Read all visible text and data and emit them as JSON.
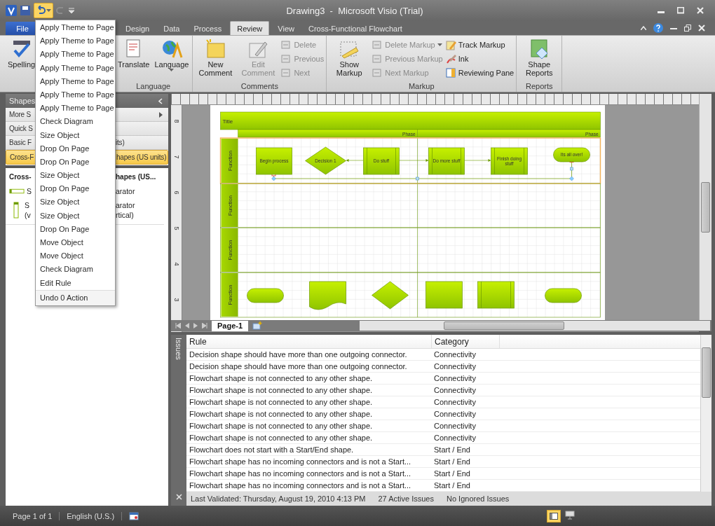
{
  "window": {
    "title": "Drawing3  -  Microsoft Visio (Trial)"
  },
  "quick_access": {
    "undo_open": true
  },
  "tabs": [
    {
      "label": "File",
      "kind": "file",
      "selected": false
    },
    {
      "label": "Design",
      "kind": "tab",
      "selected": false
    },
    {
      "label": "Data",
      "kind": "tab",
      "selected": false
    },
    {
      "label": "Process",
      "kind": "tab",
      "selected": false
    },
    {
      "label": "Review",
      "kind": "tab",
      "selected": true
    },
    {
      "label": "View",
      "kind": "tab",
      "selected": false
    },
    {
      "label": "Cross-Functional Flowchart",
      "kind": "tab",
      "selected": false
    }
  ],
  "ribbon": {
    "groups": [
      {
        "items": [
          {
            "kind": "large",
            "label": "Spelling",
            "disabled": false,
            "dropdown": false
          }
        ]
      },
      {
        "label": "Language",
        "items": [
          {
            "kind": "large",
            "label": "Translate",
            "disabled": false,
            "dropdown": false
          },
          {
            "kind": "large",
            "label": "Language",
            "disabled": false,
            "dropdown": true
          }
        ]
      },
      {
        "label": "Comments",
        "items": [
          {
            "kind": "large",
            "label": "New Comment",
            "disabled": false,
            "dropdown": false
          },
          {
            "kind": "large",
            "label": "Edit Comment",
            "disabled": true,
            "dropdown": false
          },
          {
            "kind": "stack",
            "items": [
              {
                "label": "Delete",
                "disabled": true,
                "dropdown": false
              },
              {
                "label": "Previous",
                "disabled": true,
                "dropdown": false
              },
              {
                "label": "Next",
                "disabled": true,
                "dropdown": false
              }
            ]
          }
        ]
      },
      {
        "label": "Markup",
        "items": [
          {
            "kind": "large",
            "label": "Show Markup",
            "disabled": false,
            "dropdown": false
          },
          {
            "kind": "stack",
            "items": [
              {
                "label": "Delete Markup",
                "disabled": true,
                "dropdown": true
              },
              {
                "label": "Previous Markup",
                "disabled": true,
                "dropdown": false
              },
              {
                "label": "Next Markup",
                "disabled": true,
                "dropdown": false
              }
            ]
          },
          {
            "kind": "stack",
            "items": [
              {
                "label": "Track Markup",
                "disabled": false,
                "dropdown": false
              },
              {
                "label": "Ink",
                "disabled": false,
                "dropdown": false
              },
              {
                "label": "Reviewing Pane",
                "disabled": false,
                "dropdown": false
              }
            ]
          }
        ]
      },
      {
        "label": "Reports",
        "items": [
          {
            "kind": "large",
            "label": "Shape Reports",
            "disabled": false,
            "dropdown": false
          }
        ]
      }
    ]
  },
  "undo_menu": {
    "items": [
      "Apply Theme to Page",
      "Apply Theme to Page",
      "Apply Theme to Page",
      "Apply Theme to Page",
      "Apply Theme to Page",
      "Apply Theme to Page",
      "Apply Theme to Page",
      "Check Diagram",
      "Size Object",
      "Drop On Page",
      "Drop On Page",
      "Size Object",
      "Drop On Page",
      "Size Object",
      "Size Object",
      "Drop On Page",
      "Move Object",
      "Move Object",
      "Check Diagram",
      "Edit Rule"
    ],
    "footer": "Undo 0 Action"
  },
  "shapes_panel": {
    "title": "Shapes",
    "sections": [
      {
        "left": "More S",
        "selected": false,
        "expandable": true
      },
      {
        "left": "Quick S",
        "selected": false,
        "expandable": false
      },
      {
        "left": "Basic F",
        "right": "its)",
        "selected": false,
        "expandable": false
      },
      {
        "left": "Cross-F",
        "right": "hapes (US units)",
        "selected": true,
        "expandable": false
      }
    ],
    "stencil": {
      "title_left": "Cross-",
      "title_right": "hapes (US...",
      "shapes": [
        {
          "kind": "horizontal",
          "left": [
            "S"
          ],
          "right": [
            "arator"
          ]
        },
        {
          "kind": "vertical",
          "left": [
            "S",
            "(v"
          ],
          "right": [
            "arator",
            "rtical)"
          ]
        }
      ]
    }
  },
  "vertical_ruler": [
    "8",
    "7",
    "6",
    "5",
    "4",
    "3"
  ],
  "diagram": {
    "title": "Title",
    "phases": [
      "Phase",
      "Phase"
    ],
    "lanes": [
      {
        "label": "Function",
        "selected": true
      },
      {
        "label": "Function",
        "selected": false
      },
      {
        "label": "Function",
        "selected": false
      },
      {
        "label": "Function",
        "selected": false
      }
    ],
    "shapes": [
      {
        "kind": "process",
        "label": "Begin process"
      },
      {
        "kind": "decision",
        "label": "Decision 1"
      },
      {
        "kind": "subprocess",
        "label": "Do stuff"
      },
      {
        "kind": "subprocess",
        "label": "Do more stuff"
      },
      {
        "kind": "subprocess",
        "label": "Finish doing stuff"
      },
      {
        "kind": "terminator",
        "label": "Its all over!"
      }
    ],
    "stencil_shapes": [
      {
        "kind": "terminator"
      },
      {
        "kind": "document"
      },
      {
        "kind": "decision"
      },
      {
        "kind": "process"
      },
      {
        "kind": "subprocess"
      },
      {
        "kind": "terminator"
      }
    ]
  },
  "page_tabs": [
    {
      "label": "Page-1",
      "selected": true
    }
  ],
  "issues": {
    "pane_label": "Issues",
    "columns": [
      "Rule",
      "Category"
    ],
    "rows": [
      [
        "Decision shape should have more than one outgoing connector.",
        "Connectivity"
      ],
      [
        "Decision shape should have more than one outgoing connector.",
        "Connectivity"
      ],
      [
        "Flowchart shape is not connected to any other shape.",
        "Connectivity"
      ],
      [
        "Flowchart shape is not connected to any other shape.",
        "Connectivity"
      ],
      [
        "Flowchart shape is not connected to any other shape.",
        "Connectivity"
      ],
      [
        "Flowchart shape is not connected to any other shape.",
        "Connectivity"
      ],
      [
        "Flowchart shape is not connected to any other shape.",
        "Connectivity"
      ],
      [
        "Flowchart shape is not connected to any other shape.",
        "Connectivity"
      ],
      [
        "Flowchart does not start with a Start/End shape.",
        "Start / End"
      ],
      [
        "Flowchart shape has no incoming connectors and is not a Start...",
        "Start / End"
      ],
      [
        "Flowchart shape has no incoming connectors and is not a Start...",
        "Start / End"
      ],
      [
        "Flowchart shape has no incoming connectors and is not a Start...",
        "Start / End"
      ]
    ],
    "footer": [
      "Last Validated: Thursday, August 19, 2010 4:13 PM",
      "27 Active Issues",
      "No Ignored Issues"
    ]
  },
  "status_bar": [
    "Page 1 of 1",
    "English (U.S.)"
  ]
}
